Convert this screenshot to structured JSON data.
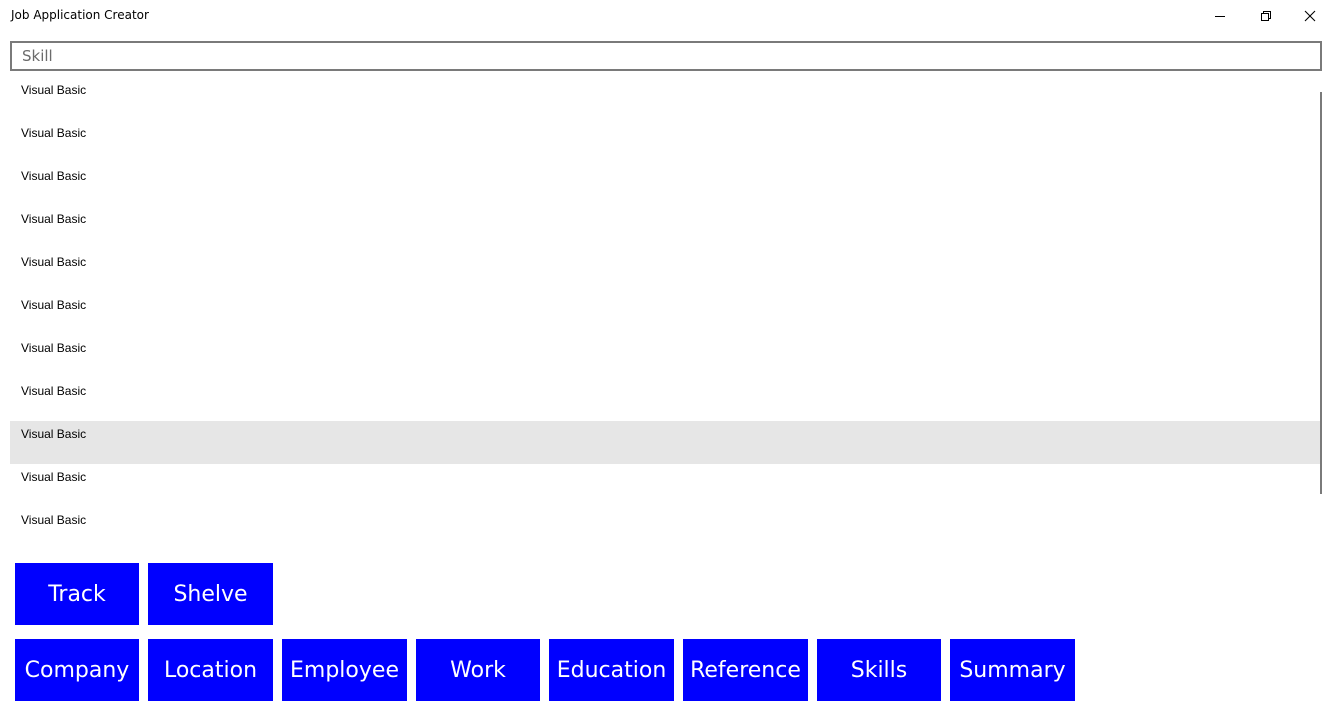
{
  "window": {
    "title": "Job Application Creator"
  },
  "caption_buttons": {
    "minimize_icon": "minimize-icon",
    "maximize_icon": "restore-icon",
    "close_icon": "close-icon"
  },
  "search": {
    "placeholder": "Skill",
    "value": ""
  },
  "skills_list": {
    "items": [
      {
        "label": "Visual Basic",
        "selected": false
      },
      {
        "label": "Visual Basic",
        "selected": false
      },
      {
        "label": "Visual Basic",
        "selected": false
      },
      {
        "label": "Visual Basic",
        "selected": false
      },
      {
        "label": "Visual Basic",
        "selected": false
      },
      {
        "label": "Visual Basic",
        "selected": false
      },
      {
        "label": "Visual Basic",
        "selected": false
      },
      {
        "label": "Visual Basic",
        "selected": false
      },
      {
        "label": "Visual Basic",
        "selected": true
      },
      {
        "label": "Visual Basic",
        "selected": false
      },
      {
        "label": "Visual Basic",
        "selected": false
      }
    ]
  },
  "actions": {
    "track_label": "Track",
    "shelve_label": "Shelve"
  },
  "nav": {
    "items": [
      {
        "label": "Company"
      },
      {
        "label": "Location"
      },
      {
        "label": "Employee"
      },
      {
        "label": "Work"
      },
      {
        "label": "Education"
      },
      {
        "label": "Reference"
      },
      {
        "label": "Skills"
      },
      {
        "label": "Summary"
      }
    ]
  },
  "colors": {
    "button_bg": "#0000ff",
    "button_text": "#ffffff",
    "selected_row": "#e6e6e6"
  }
}
